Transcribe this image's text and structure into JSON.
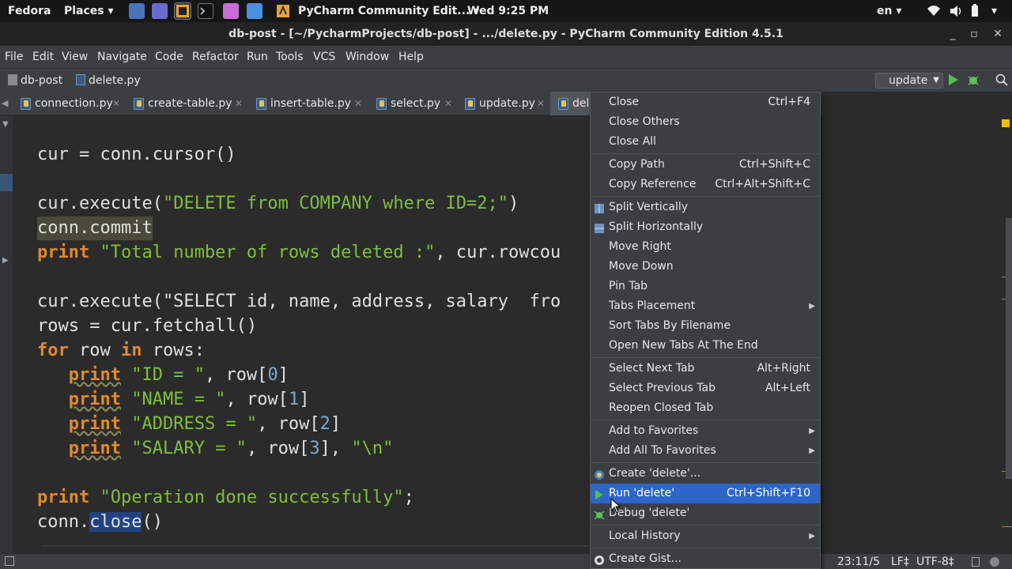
{
  "topbar": {
    "activities": "Fedora",
    "places": "Places ▾",
    "app_menu": "PyCharm Community Edit... ▾",
    "clock": "Wed  9:25 PM",
    "keyboard": "en ▾"
  },
  "window": {
    "title": "db-post - [~/PycharmProjects/db-post] - .../delete.py - PyCharm Community Edition 4.5.1"
  },
  "menubar": [
    "File",
    "Edit",
    "View",
    "Navigate",
    "Code",
    "Refactor",
    "Run",
    "Tools",
    "VCS",
    "Window",
    "Help"
  ],
  "navbar": {
    "project": "db-post",
    "file": "delete.py",
    "run_config": "update"
  },
  "tabs": [
    {
      "label": "connection.py"
    },
    {
      "label": "create-table.py"
    },
    {
      "label": "insert-table.py"
    },
    {
      "label": "select.py"
    },
    {
      "label": "update.py"
    },
    {
      "label": "dele"
    }
  ],
  "editor": {
    "lines": [
      "cur = conn.cursor()",
      "cur.execute(\"DELETE from COMPANY where ID=2;\")",
      "conn.commit",
      "print \"Total number of rows deleted :\", cur.rowcou",
      "cur.execute(\"SELECT id, name, address, salary  fro",
      "rows = cur.fetchall()",
      "for row in rows:",
      "   print \"ID = \", row[0]",
      "   print \"NAME = \", row[1]",
      "   print \"ADDRESS = \", row[2]",
      "   print \"SALARY = \", row[3], \"\\n\"",
      "print \"Operation done successfully\";",
      "conn.close()"
    ]
  },
  "status": {
    "position": "23:11/5",
    "line_sep": "LF‡",
    "encoding": "UTF-8‡"
  },
  "context_menu": {
    "items": [
      {
        "label": "Close",
        "shortcut": "Ctrl+F4"
      },
      {
        "label": "Close Others",
        "shortcut": ""
      },
      {
        "label": "Close All",
        "shortcut": ""
      },
      {
        "label": "Copy Path",
        "shortcut": "Ctrl+Shift+C"
      },
      {
        "label": "Copy Reference",
        "shortcut": "Ctrl+Alt+Shift+C"
      },
      {
        "label": "Split Vertically",
        "shortcut": ""
      },
      {
        "label": "Split Horizontally",
        "shortcut": ""
      },
      {
        "label": "Move Right",
        "shortcut": ""
      },
      {
        "label": "Move Down",
        "shortcut": ""
      },
      {
        "label": "Pin Tab",
        "shortcut": ""
      },
      {
        "label": "Tabs Placement",
        "shortcut": ""
      },
      {
        "label": "Sort Tabs By Filename",
        "shortcut": ""
      },
      {
        "label": "Open New Tabs At The End",
        "shortcut": ""
      },
      {
        "label": "Select Next Tab",
        "shortcut": "Alt+Right"
      },
      {
        "label": "Select Previous Tab",
        "shortcut": "Alt+Left"
      },
      {
        "label": "Reopen Closed Tab",
        "shortcut": ""
      },
      {
        "label": "Add to Favorites",
        "shortcut": ""
      },
      {
        "label": "Add All To Favorites",
        "shortcut": ""
      },
      {
        "label": "Create 'delete'...",
        "shortcut": ""
      },
      {
        "label": "Run 'delete'",
        "shortcut": "Ctrl+Shift+F10"
      },
      {
        "label": "Debug 'delete'",
        "shortcut": ""
      },
      {
        "label": "Local History",
        "shortcut": ""
      },
      {
        "label": "Create Gist...",
        "shortcut": ""
      }
    ]
  },
  "colors": {
    "editor_bg": "#2b2b2b",
    "keyword": "#de8a2f",
    "string": "#7fbf3c",
    "number": "#79a9d4",
    "menu_selected": "#2f65ca",
    "panel_bg": "#3c3f41"
  }
}
